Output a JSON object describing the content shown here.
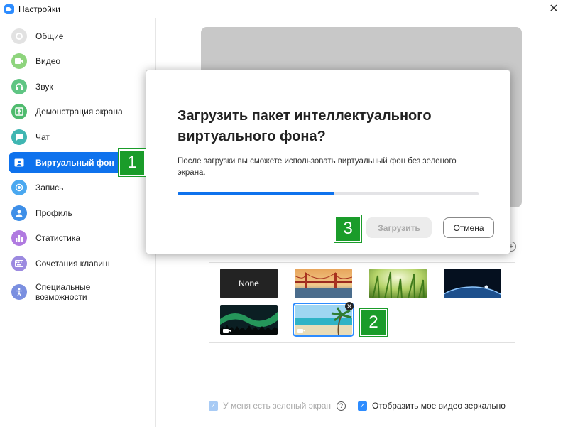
{
  "window": {
    "title": "Настройки"
  },
  "sidebar": {
    "items": [
      {
        "label": "Общие",
        "icon": "gear-icon",
        "color": "#d9d9d9",
        "active": false
      },
      {
        "label": "Видео",
        "icon": "video-icon",
        "color": "#8ed47d",
        "active": false
      },
      {
        "label": "Звук",
        "icon": "headphones-icon",
        "color": "#5fc583",
        "active": false
      },
      {
        "label": "Демонстрация экрана",
        "icon": "share-screen-icon",
        "color": "#4fbb6e",
        "active": false
      },
      {
        "label": "Чат",
        "icon": "chat-icon",
        "color": "#3fb6b2",
        "active": false
      },
      {
        "label": "Виртуальный фон",
        "icon": "virtual-background-icon",
        "color": "#0e72ed",
        "active": true
      },
      {
        "label": "Запись",
        "icon": "record-icon",
        "color": "#4aa8f0",
        "active": false
      },
      {
        "label": "Профиль",
        "icon": "profile-icon",
        "color": "#3e8fe8",
        "active": false
      },
      {
        "label": "Статистика",
        "icon": "statistics-icon",
        "color": "#b07ae0",
        "active": false
      },
      {
        "label": "Сочетания клавиш",
        "icon": "keyboard-icon",
        "color": "#9c8ae0",
        "active": false
      },
      {
        "label": "Специальные возможности",
        "icon": "accessibility-icon",
        "color": "#7a8fe0",
        "active": false
      }
    ]
  },
  "gallery": {
    "none_label": "None"
  },
  "options": {
    "green_screen_label": "У меня есть зеленый экран",
    "mirror_label": "Отобразить мое видео зеркально"
  },
  "modal": {
    "title": "Загрузить пакет интеллектуального виртуального фона?",
    "body": "После загрузки вы сможете использовать виртуальный фон без зеленого экрана.",
    "progress": 0.52,
    "primary_label": "Загрузить",
    "cancel_label": "Отмена"
  },
  "markers": [
    "1",
    "2",
    "3"
  ],
  "colors": {
    "accent": "#0e72ed",
    "marker": "#1a9c2a"
  }
}
